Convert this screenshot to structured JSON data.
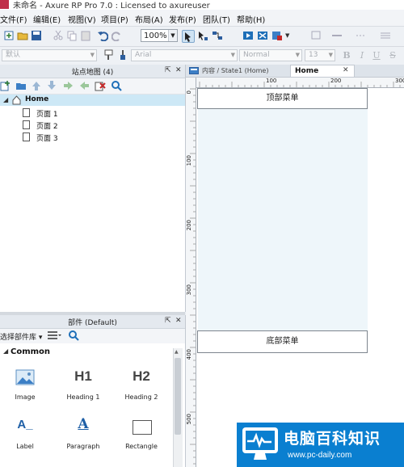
{
  "window": {
    "title": "未命名 - Axure RP Pro 7.0 : Licensed to axureuser"
  },
  "menu": [
    "文件(F)",
    "编辑(E)",
    "视图(V)",
    "项目(P)",
    "布局(A)",
    "发布(P)",
    "团队(T)",
    "帮助(H)"
  ],
  "toolbar": {
    "zoom": "100%"
  },
  "style_toolbar": {
    "style": "默认",
    "font": "Arial",
    "weight": "Normal",
    "size": "13",
    "bold": "B",
    "italic": "I",
    "underline": "U",
    "strike": "S"
  },
  "sitemap": {
    "title": "站点地图 (4)",
    "root": "Home",
    "pages": [
      "页面 1",
      "页面 2",
      "页面 3"
    ]
  },
  "widgets": {
    "title": "部件 (Default)",
    "library_label": "选择部件库",
    "group": "Common",
    "items": [
      {
        "label": "Image",
        "glyph": ""
      },
      {
        "label": "Heading 1",
        "glyph": "H1"
      },
      {
        "label": "Heading 2",
        "glyph": "H2"
      },
      {
        "label": "Label",
        "glyph": "A_"
      },
      {
        "label": "Paragraph",
        "glyph": "A"
      },
      {
        "label": "Rectangle",
        "glyph": ""
      }
    ]
  },
  "tabs": {
    "state_tab": "内容 / State1 (Home)",
    "active_tab": "Home",
    "close": "✕"
  },
  "ruler": {
    "h": [
      "100",
      "200",
      "300"
    ],
    "v": [
      "0",
      "100",
      "200",
      "300",
      "400",
      "500"
    ]
  },
  "canvas": {
    "top_menu": "顶部菜单",
    "bottom_menu": "底部菜单"
  },
  "watermark": {
    "name": "电脑百科知识",
    "url": "www.pc-daily.com"
  },
  "colors": {
    "selection": "#cde8f6",
    "panel_fill": "#eef6fa",
    "watermark": "#0a7fd0"
  }
}
